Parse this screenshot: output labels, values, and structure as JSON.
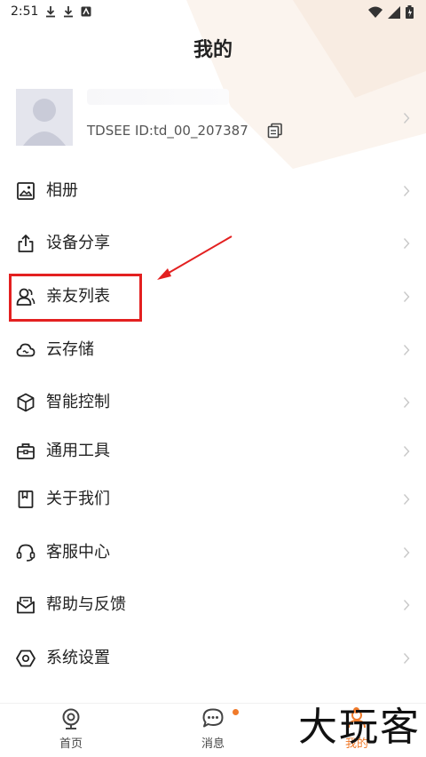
{
  "status_bar": {
    "time": "2:51"
  },
  "header": {
    "title": "我的"
  },
  "profile": {
    "id_text": "TDSEE  ID:td_00_207387"
  },
  "menu": [
    {
      "label": "相册",
      "icon": "image-icon"
    },
    {
      "label": "设备分享",
      "icon": "share-icon"
    },
    {
      "label": "亲友列表",
      "icon": "users-icon"
    },
    {
      "label": "云存储",
      "icon": "cloud-icon"
    },
    {
      "label": "智能控制",
      "icon": "cube-icon"
    },
    {
      "label": "通用工具",
      "icon": "toolbox-icon"
    },
    {
      "label": "关于我们",
      "icon": "bookmark-icon"
    },
    {
      "label": "客服中心",
      "icon": "headset-icon"
    },
    {
      "label": "帮助与反馈",
      "icon": "mail-icon"
    },
    {
      "label": "系统设置",
      "icon": "settings-icon"
    }
  ],
  "bottom_nav": [
    {
      "label": "首页",
      "icon": "camera-icon"
    },
    {
      "label": "消息",
      "icon": "chat-icon",
      "badge": true
    },
    {
      "label": "我的",
      "icon": "profile-icon",
      "badge": true
    }
  ],
  "watermark": "大玩客",
  "colors": {
    "highlight": "#e32020",
    "badge": "#f07a2a",
    "text": "#222222"
  }
}
